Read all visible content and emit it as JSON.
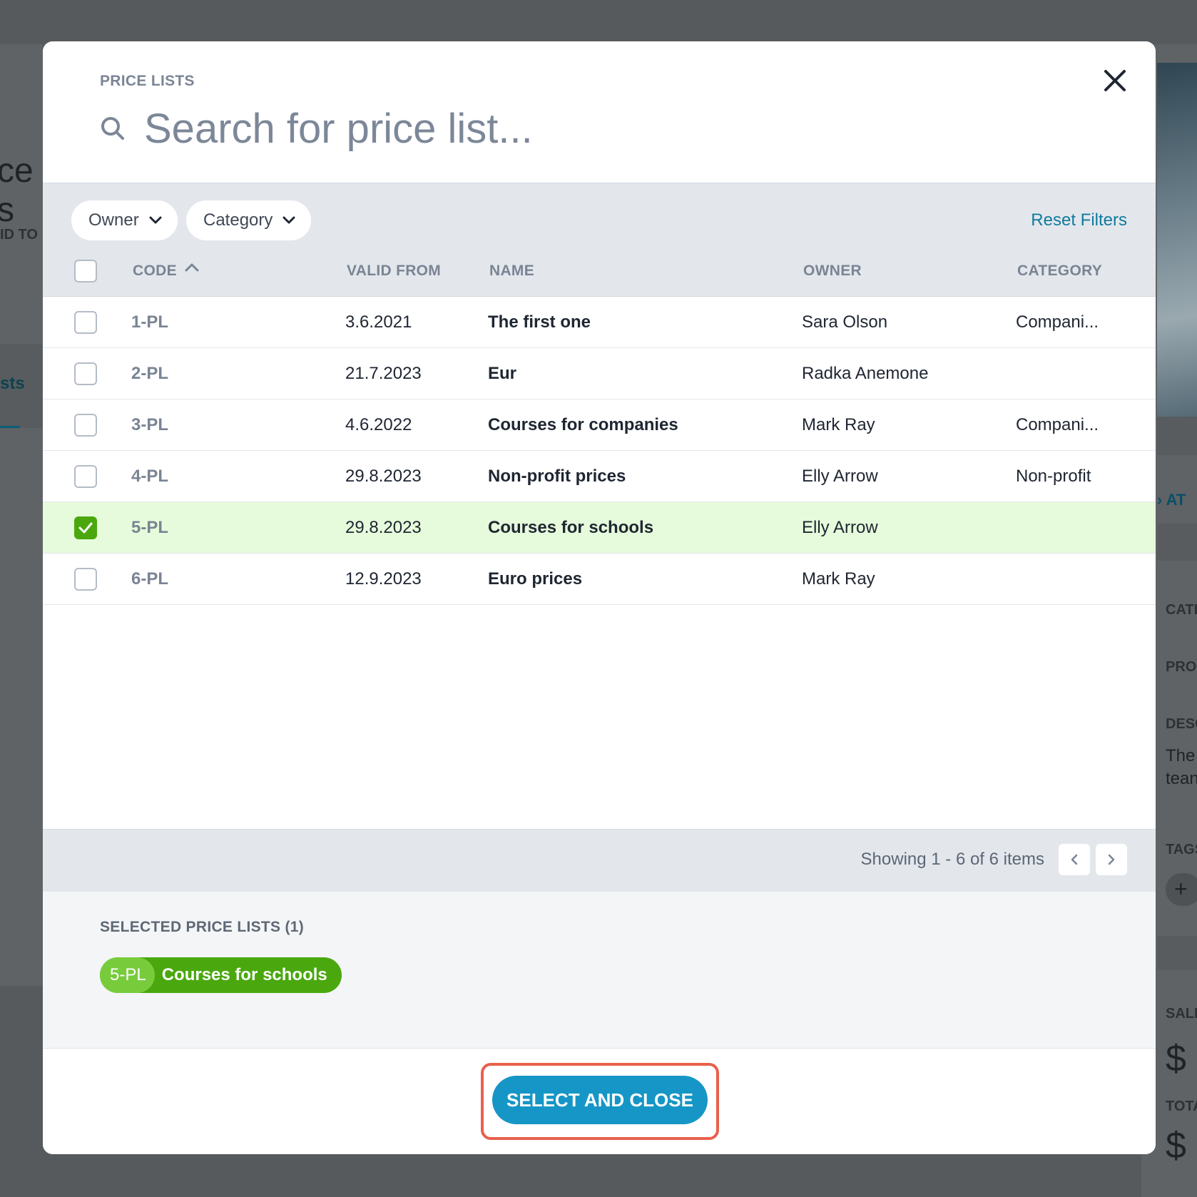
{
  "background": {
    "left_fragment": "ce s",
    "left_label": "ID TO",
    "left_tab": "sts",
    "right_arrow_text": "› AT",
    "right_labels": [
      "CATE",
      "PRO",
      "DESC",
      "TAGS",
      "SALE",
      "TOTA"
    ],
    "right_description": [
      "The",
      "tean"
    ],
    "currency_symbol": "$",
    "plus": "+"
  },
  "modal": {
    "subtitle": "PRICE LISTS",
    "search_placeholder": "Search for price list...",
    "search_value": ""
  },
  "filters": {
    "owner_label": "Owner",
    "category_label": "Category",
    "reset_label": "Reset Filters"
  },
  "table": {
    "columns": {
      "code": "CODE",
      "valid_from": "VALID FROM",
      "name": "NAME",
      "owner": "OWNER",
      "category": "CATEGORY"
    },
    "sort": {
      "column": "code",
      "direction": "ascending"
    },
    "rows": [
      {
        "code": "1-PL",
        "valid_from": "3.6.2021",
        "name": "The first one",
        "owner": "Sara Olson",
        "category": "Compani...",
        "selected": false
      },
      {
        "code": "2-PL",
        "valid_from": "21.7.2023",
        "name": "Eur",
        "owner": "Radka Anemone",
        "category": "",
        "selected": false
      },
      {
        "code": "3-PL",
        "valid_from": "4.6.2022",
        "name": "Courses for companies",
        "owner": "Mark Ray",
        "category": "Compani...",
        "selected": false
      },
      {
        "code": "4-PL",
        "valid_from": "29.8.2023",
        "name": "Non-profit prices",
        "owner": "Elly Arrow",
        "category": "Non-profit",
        "selected": false
      },
      {
        "code": "5-PL",
        "valid_from": "29.8.2023",
        "name": "Courses for schools",
        "owner": "Elly Arrow",
        "category": "",
        "selected": true
      },
      {
        "code": "6-PL",
        "valid_from": "12.9.2023",
        "name": "Euro prices",
        "owner": "Mark Ray",
        "category": "",
        "selected": false
      }
    ]
  },
  "pagination": {
    "summary": "Showing 1 - 6 of 6 items"
  },
  "selection": {
    "title": "SELECTED PRICE LISTS (1)",
    "chips": [
      {
        "code": "5-PL",
        "name": "Courses for schools"
      }
    ]
  },
  "footer": {
    "primary_label": "SELECT AND CLOSE"
  },
  "colors": {
    "accent": "#1696c6",
    "link": "#117a9e",
    "selected_green": "#4aa80e",
    "selected_row_bg": "#e6fbdb",
    "highlight_outline": "#e8604c"
  }
}
